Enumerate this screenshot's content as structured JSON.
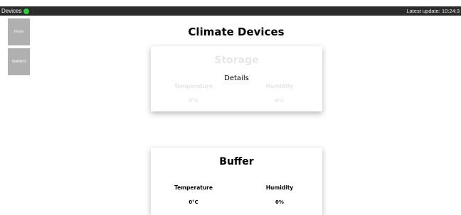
{
  "header": {
    "title": "Devices",
    "status_color": "#2ecc40",
    "last_update": "Latest update: 10:24:3"
  },
  "sidebar": {
    "items": [
      {
        "label": "Home"
      },
      {
        "label": "Statistics"
      }
    ]
  },
  "main": {
    "title": "Climate Devices",
    "devices": [
      {
        "name": "Storage",
        "details_label": "Details",
        "temperature_label": "Temperature",
        "temperature_value": "0°C",
        "humidity_label": "Humidity",
        "humidity_value": "0%"
      },
      {
        "name": "Buffer",
        "temperature_label": "Temperature",
        "temperature_value": "0°C",
        "humidity_label": "Humidity",
        "humidity_value": "0%"
      }
    ]
  }
}
